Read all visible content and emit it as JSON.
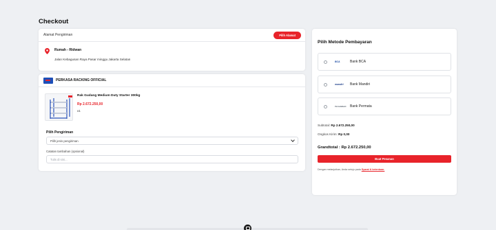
{
  "page": {
    "title": "Checkout"
  },
  "address": {
    "header_label": "Alamat Pengiriman",
    "choose_button": "Pilih Alamat",
    "name": "Rumah - Ridwan",
    "line": "Jalan Kebagusan Raya Pasar minggu Jakarta Selatan",
    "pin_icon": "location-pin-icon",
    "pin_color": "#e8232a"
  },
  "order": {
    "store_name": "PERKASA RACKING OFFICIAL",
    "product": {
      "name": "Rak Gudang Medium Duty Starter 300kg",
      "price": "Rp 2.672.250,00",
      "qty": "x1"
    },
    "shipping": {
      "label": "Pilih Pengiriman",
      "selected": "Pilih jenis pengiriman"
    },
    "note": {
      "label": "Catatan tambahan (opsional)",
      "placeholder": "Tulis di sini..."
    }
  },
  "payment": {
    "title": "Pilih Metode Pembayaran",
    "banks": [
      {
        "logo": "BCA",
        "name": "Bank BCA",
        "logo_color": "#1a4aa3"
      },
      {
        "logo": "mandiri",
        "name": "Bank Mandiri",
        "logo_color": "#1f3f8a"
      },
      {
        "logo": "PermataBank",
        "name": "Bank Permata",
        "logo_color": "#5b6570"
      }
    ],
    "subtotal_label": "Subtotal:",
    "subtotal_value": "Rp 2.672.250,00",
    "shipping_label": "Ongkos Kirim:",
    "shipping_value": "Rp 0,00",
    "grandtotal": "Grandtotal : Rp 2.672.250,00",
    "submit_button": "Buat Pesanan",
    "terms_text": "Dengan melanjutkan, Anda setuju pada",
    "terms_link": "Syarat & ketentuan."
  },
  "colors": {
    "accent": "#e8232a",
    "background": "#eef0f3"
  }
}
